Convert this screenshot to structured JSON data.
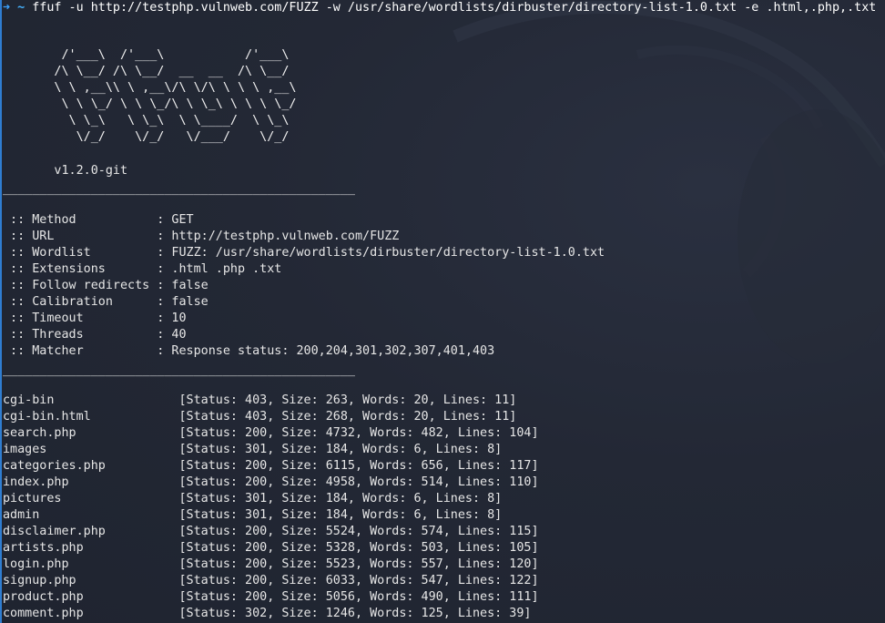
{
  "prompt": {
    "arrow": "➜",
    "dir": "~",
    "command": "ffuf -u http://testphp.vulnweb.com/FUZZ -w /usr/share/wordlists/dirbuster/directory-list-1.0.txt -e .html,.php,.txt"
  },
  "banner": [
    "        /'___\\  /'___\\           /'___\\",
    "       /\\ \\__/ /\\ \\__/  __  __  /\\ \\__/",
    "       \\ \\ ,__\\\\ \\ ,__\\/\\ \\/\\ \\ \\ \\ ,__\\",
    "        \\ \\ \\_/ \\ \\ \\_/\\ \\ \\_\\ \\ \\ \\ \\_/",
    "         \\ \\_\\   \\ \\_\\  \\ \\____/  \\ \\_\\",
    "          \\/_/    \\/_/   \\/___/    \\/_/"
  ],
  "version": "       v1.2.0-git",
  "separator": "________________________________________________",
  "config": [
    " :: Method           : GET",
    " :: URL              : http://testphp.vulnweb.com/FUZZ",
    " :: Wordlist         : FUZZ: /usr/share/wordlists/dirbuster/directory-list-1.0.txt",
    " :: Extensions       : .html .php .txt",
    " :: Follow redirects : false",
    " :: Calibration      : false",
    " :: Timeout          : 10",
    " :: Threads          : 40",
    " :: Matcher          : Response status: 200,204,301,302,307,401,403"
  ],
  "results": [
    "cgi-bin                 [Status: 403, Size: 263, Words: 20, Lines: 11]",
    "cgi-bin.html            [Status: 403, Size: 268, Words: 20, Lines: 11]",
    "search.php              [Status: 200, Size: 4732, Words: 482, Lines: 104]",
    "images                  [Status: 301, Size: 184, Words: 6, Lines: 8]",
    "categories.php          [Status: 200, Size: 6115, Words: 656, Lines: 117]",
    "index.php               [Status: 200, Size: 4958, Words: 514, Lines: 110]",
    "pictures                [Status: 301, Size: 184, Words: 6, Lines: 8]",
    "admin                   [Status: 301, Size: 184, Words: 6, Lines: 8]",
    "disclaimer.php          [Status: 200, Size: 5524, Words: 574, Lines: 115]",
    "artists.php             [Status: 200, Size: 5328, Words: 503, Lines: 105]",
    "login.php               [Status: 200, Size: 5523, Words: 557, Lines: 120]",
    "signup.php              [Status: 200, Size: 6033, Words: 547, Lines: 122]",
    "product.php             [Status: 200, Size: 5056, Words: 490, Lines: 111]",
    "comment.php             [Status: 302, Size: 1246, Words: 125, Lines: 39]"
  ]
}
